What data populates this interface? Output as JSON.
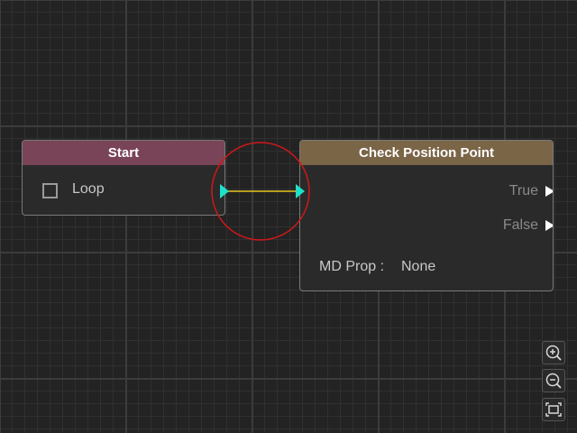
{
  "nodes": {
    "start": {
      "title": "Start",
      "loop_label": "Loop"
    },
    "check_position_point": {
      "title": "Check Position Point",
      "outputs": [
        "True",
        "False"
      ],
      "prop_label": "MD Prop :",
      "prop_value": "None"
    }
  },
  "colors": {
    "background": "#232323",
    "start_header": "#7a4458",
    "check_header": "#7b6547",
    "connection_line": "#e8c81e",
    "port": "#1fe0c8",
    "highlight_circle": "#d01818"
  },
  "controls": {
    "icons": [
      "zoom-in-icon",
      "zoom-out-icon",
      "fit-view-icon"
    ]
  }
}
